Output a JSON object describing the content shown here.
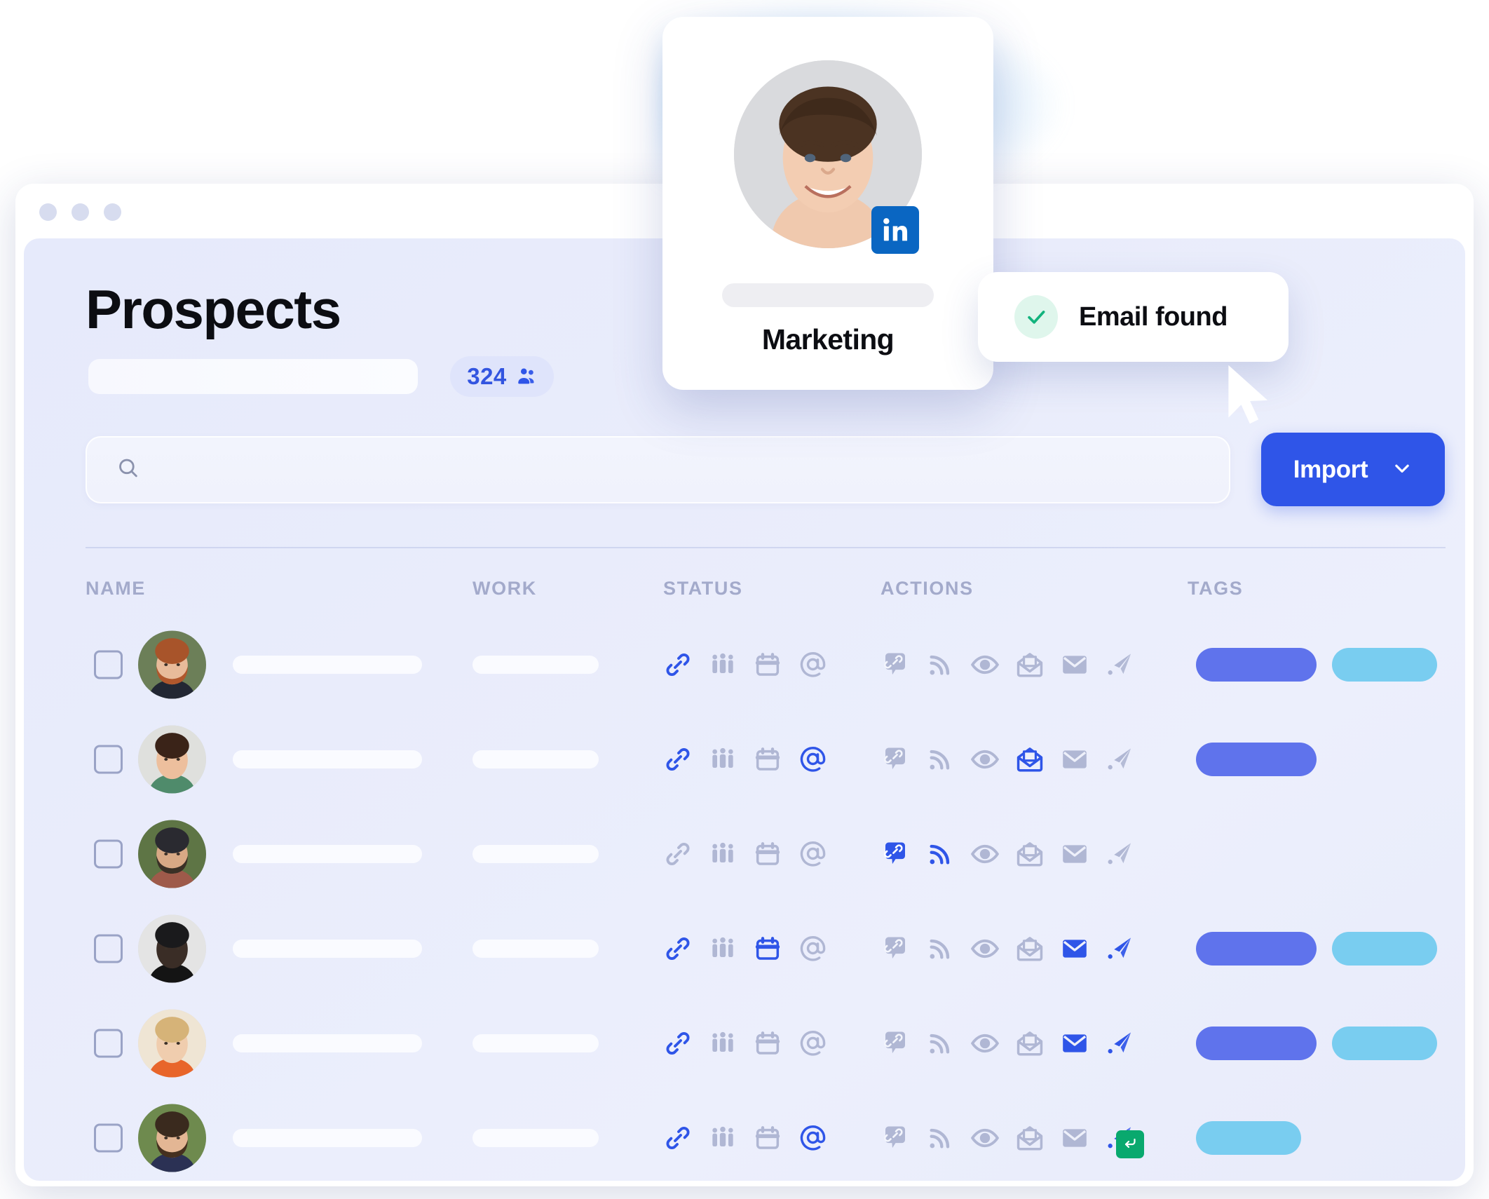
{
  "window": {
    "traffic_dots": [
      "dot-1",
      "dot-2",
      "dot-3"
    ]
  },
  "header": {
    "title": "Prospects",
    "count": "324",
    "count_icon": "people-icon"
  },
  "search": {
    "icon": "search-icon",
    "value": "",
    "placeholder": ""
  },
  "toolbar": {
    "import_label": "Import",
    "import_chevron": "chevron-down-icon"
  },
  "table": {
    "columns": [
      "NAME",
      "WORK",
      "STATUS",
      "ACTIONS",
      "TAGS"
    ],
    "status_icons": [
      "link-icon",
      "people-group-icon",
      "calendar-icon",
      "at-icon"
    ],
    "action_icons": [
      "message-link-icon",
      "rss-icon",
      "eye-icon",
      "envelope-open-icon",
      "envelope-closed-icon",
      "paper-plane-icon"
    ],
    "rows": [
      {
        "checked": false,
        "avatar": "avatar-bearded-man",
        "status_active": [
          true,
          false,
          false,
          false
        ],
        "actions_active": [
          false,
          false,
          false,
          false,
          false,
          false
        ],
        "actions_filled": [
          false,
          false,
          false,
          false,
          false,
          false
        ],
        "tags": [
          "primary",
          "accent"
        ],
        "reply_badge": false
      },
      {
        "checked": false,
        "avatar": "avatar-curly-woman",
        "status_active": [
          true,
          false,
          false,
          true
        ],
        "actions_active": [
          false,
          false,
          false,
          true,
          false,
          false
        ],
        "actions_filled": [
          false,
          false,
          false,
          false,
          false,
          false
        ],
        "tags": [
          "primary"
        ],
        "reply_badge": false
      },
      {
        "checked": false,
        "avatar": "avatar-cap-man",
        "status_active": [
          false,
          false,
          false,
          false
        ],
        "actions_active": [
          true,
          true,
          false,
          false,
          false,
          false
        ],
        "actions_filled": [
          true,
          false,
          false,
          false,
          false,
          false
        ],
        "tags": [],
        "reply_badge": false
      },
      {
        "checked": false,
        "avatar": "avatar-profile-man",
        "status_active": [
          true,
          false,
          true,
          false
        ],
        "actions_active": [
          false,
          false,
          false,
          false,
          true,
          true
        ],
        "actions_filled": [
          false,
          false,
          false,
          false,
          false,
          false
        ],
        "tags": [
          "primary",
          "accent"
        ],
        "reply_badge": false
      },
      {
        "checked": false,
        "avatar": "avatar-blonde-woman",
        "status_active": [
          true,
          false,
          false,
          false
        ],
        "actions_active": [
          false,
          false,
          false,
          false,
          true,
          true
        ],
        "actions_filled": [
          false,
          false,
          false,
          false,
          false,
          false
        ],
        "tags": [
          "primary",
          "accent"
        ],
        "reply_badge": false
      },
      {
        "checked": false,
        "avatar": "avatar-knowtify-man",
        "status_active": [
          true,
          false,
          false,
          true
        ],
        "actions_active": [
          false,
          false,
          false,
          false,
          false,
          true
        ],
        "actions_filled": [
          false,
          false,
          false,
          false,
          false,
          false
        ],
        "tags": [
          "accent"
        ],
        "reply_badge": true
      }
    ]
  },
  "profile_card": {
    "avatar": "avatar-smiling-man",
    "network_badge": "linkedin-icon",
    "name_skeleton": "",
    "label": "Marketing"
  },
  "toast": {
    "icon": "check-icon",
    "label": "Email found"
  },
  "cursor": {
    "icon": "mouse-pointer-icon"
  },
  "colors": {
    "accent_blue": "#2f55e8",
    "icon_active": "#2f55e8",
    "icon_muted": "#b0b7d4",
    "tag_primary": "#5f73ec",
    "tag_accent": "#79cdf0",
    "success_green": "#09a96e",
    "linkedin_blue": "#0a66c2",
    "app_background": "#e9ecfb"
  }
}
